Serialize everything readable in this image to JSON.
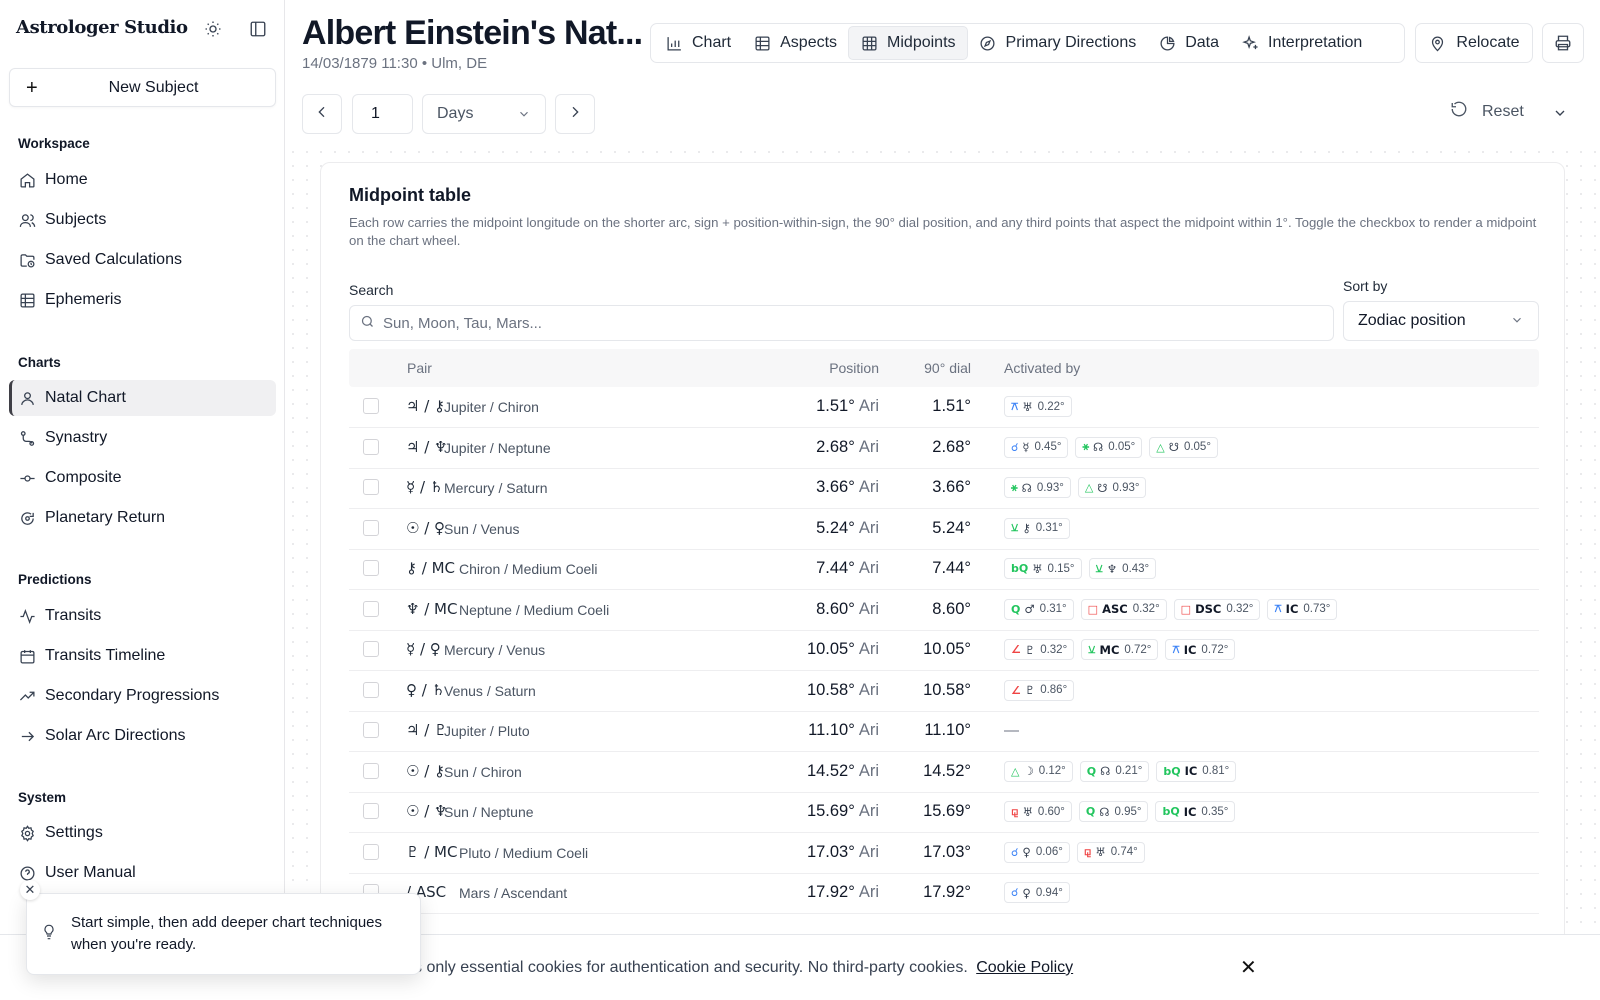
{
  "app": {
    "brand": "Astrologer Studio",
    "new_subject": "New Subject"
  },
  "sidebar": {
    "groups": [
      {
        "label": "Workspace",
        "items": [
          "Home",
          "Subjects",
          "Saved Calculations",
          "Ephemeris"
        ]
      },
      {
        "label": "Charts",
        "items": [
          "Natal Chart",
          "Synastry",
          "Composite",
          "Planetary Return"
        ]
      },
      {
        "label": "Predictions",
        "items": [
          "Transits",
          "Transits Timeline",
          "Secondary Progressions",
          "Solar Arc Directions"
        ]
      },
      {
        "label": "System",
        "items": [
          "Settings",
          "User Manual"
        ]
      }
    ],
    "active_item": "Natal Chart"
  },
  "header": {
    "title": "Albert Einstein's Nat...",
    "subtitle": "14/03/1879 11:30 • Ulm, DE",
    "tabs": [
      "Chart",
      "Aspects",
      "Midpoints",
      "Primary Directions",
      "Data",
      "Interpretation"
    ],
    "active_tab": "Midpoints",
    "relocate": "Relocate"
  },
  "controls": {
    "step_value": "1",
    "unit": "Days",
    "reset": "Reset"
  },
  "card": {
    "title": "Midpoint table",
    "description": "Each row carries the midpoint longitude on the shorter arc, sign + position-within-sign, the 90° dial position, and any third points that aspect the midpoint within 1°. Toggle the checkbox to render a midpoint on the chart wheel.",
    "search_label": "Search",
    "search_placeholder": "Sun, Moon, Tau, Mars...",
    "sort_label": "Sort by",
    "sort_value": "Zodiac position",
    "columns": [
      "Pair",
      "Position",
      "90° dial",
      "Activated by"
    ]
  },
  "rows": [
    {
      "glyphs": "♃ / ⚷",
      "name": "Jupiter / Chiron",
      "pos": "1.51°",
      "sign": "Ari",
      "dial": "1.51°",
      "chips": [
        {
          "asp": "⚻",
          "pt": "♅",
          "orb": "0.22°",
          "c": "#3b82f6"
        }
      ]
    },
    {
      "glyphs": "♃ / ♆",
      "name": "Jupiter / Neptune",
      "pos": "2.68°",
      "sign": "Ari",
      "dial": "2.68°",
      "chips": [
        {
          "asp": "☌",
          "pt": "☿",
          "orb": "0.45°",
          "c": "#3b82f6"
        },
        {
          "asp": "⚹",
          "pt": "☊",
          "orb": "0.05°",
          "c": "#22c55e"
        },
        {
          "asp": "△",
          "pt": "☋",
          "orb": "0.05°",
          "c": "#22c55e"
        }
      ]
    },
    {
      "glyphs": "☿ / ♄",
      "name": "Mercury / Saturn",
      "pos": "3.66°",
      "sign": "Ari",
      "dial": "3.66°",
      "chips": [
        {
          "asp": "⚹",
          "pt": "☊",
          "orb": "0.93°",
          "c": "#22c55e"
        },
        {
          "asp": "△",
          "pt": "☋",
          "orb": "0.93°",
          "c": "#22c55e"
        }
      ]
    },
    {
      "glyphs": "☉ / ♀",
      "name": "Sun / Venus",
      "pos": "5.24°",
      "sign": "Ari",
      "dial": "5.24°",
      "chips": [
        {
          "asp": "⚺",
          "pt": "⚷",
          "orb": "0.31°",
          "c": "#22c55e"
        }
      ]
    },
    {
      "glyphs": "⚷ / MC",
      "name": "Chiron / Medium Coeli",
      "pos": "7.44°",
      "sign": "Ari",
      "dial": "7.44°",
      "chips": [
        {
          "asp": "bQ",
          "pt": "♅",
          "orb": "0.15°",
          "c": "#22c55e"
        },
        {
          "asp": "⚺",
          "pt": "♆",
          "orb": "0.43°",
          "c": "#22c55e"
        }
      ]
    },
    {
      "glyphs": "♆ / MC",
      "name": "Neptune / Medium Coeli",
      "pos": "8.60°",
      "sign": "Ari",
      "dial": "8.60°",
      "chips": [
        {
          "asp": "Q",
          "pt": "♂",
          "orb": "0.31°",
          "c": "#22c55e"
        },
        {
          "asp": "□",
          "pt": "ASC",
          "orb": "0.32°",
          "c": "#ef4444"
        },
        {
          "asp": "□",
          "pt": "DSC",
          "orb": "0.32°",
          "c": "#ef4444"
        },
        {
          "asp": "⚻",
          "pt": "IC",
          "orb": "0.73°",
          "c": "#3b82f6"
        }
      ]
    },
    {
      "glyphs": "☿ / ♀",
      "name": "Mercury / Venus",
      "pos": "10.05°",
      "sign": "Ari",
      "dial": "10.05°",
      "chips": [
        {
          "asp": "∠",
          "pt": "♇",
          "orb": "0.32°",
          "c": "#ef4444"
        },
        {
          "asp": "⚺",
          "pt": "MC",
          "orb": "0.72°",
          "c": "#22c55e"
        },
        {
          "asp": "⚻",
          "pt": "IC",
          "orb": "0.72°",
          "c": "#3b82f6"
        }
      ]
    },
    {
      "glyphs": "♀ / ♄",
      "name": "Venus / Saturn",
      "pos": "10.58°",
      "sign": "Ari",
      "dial": "10.58°",
      "chips": [
        {
          "asp": "∠",
          "pt": "♇",
          "orb": "0.86°",
          "c": "#ef4444"
        }
      ]
    },
    {
      "glyphs": "♃ / ♇",
      "name": "Jupiter / Pluto",
      "pos": "11.10°",
      "sign": "Ari",
      "dial": "11.10°",
      "chips": [],
      "empty": "—"
    },
    {
      "glyphs": "☉ / ⚷",
      "name": "Sun / Chiron",
      "pos": "14.52°",
      "sign": "Ari",
      "dial": "14.52°",
      "chips": [
        {
          "asp": "△",
          "pt": "☽",
          "orb": "0.12°",
          "c": "#22c55e"
        },
        {
          "asp": "Q",
          "pt": "☊",
          "orb": "0.21°",
          "c": "#22c55e"
        },
        {
          "asp": "bQ",
          "pt": "IC",
          "orb": "0.81°",
          "c": "#22c55e"
        }
      ]
    },
    {
      "glyphs": "☉ / ♆",
      "name": "Sun / Neptune",
      "pos": "15.69°",
      "sign": "Ari",
      "dial": "15.69°",
      "chips": [
        {
          "asp": "⚼",
          "pt": "♅",
          "orb": "0.60°",
          "c": "#ef4444"
        },
        {
          "asp": "Q",
          "pt": "☊",
          "orb": "0.95°",
          "c": "#22c55e"
        },
        {
          "asp": "bQ",
          "pt": "IC",
          "orb": "0.35°",
          "c": "#22c55e"
        }
      ]
    },
    {
      "glyphs": "♇ / MC",
      "name": "Pluto / Medium Coeli",
      "pos": "17.03°",
      "sign": "Ari",
      "dial": "17.03°",
      "chips": [
        {
          "asp": "☌",
          "pt": "♀",
          "orb": "0.06°",
          "c": "#3b82f6"
        },
        {
          "asp": "⚼",
          "pt": "♅",
          "orb": "0.74°",
          "c": "#ef4444"
        }
      ]
    },
    {
      "glyphs": "/ ASC",
      "name": "Mars / Ascendant",
      "pos": "17.92°",
      "sign": "Ari",
      "dial": "17.92°",
      "chips": [
        {
          "asp": "☌",
          "pt": "♀",
          "orb": "0.94°",
          "c": "#3b82f6"
        }
      ]
    }
  ],
  "toast": {
    "text": "Start simple, then add deeper chart techniques when you're ready."
  },
  "cookie": {
    "text": "s only essential cookies for authentication and security. No third-party cookies.",
    "link": "Cookie Policy"
  }
}
